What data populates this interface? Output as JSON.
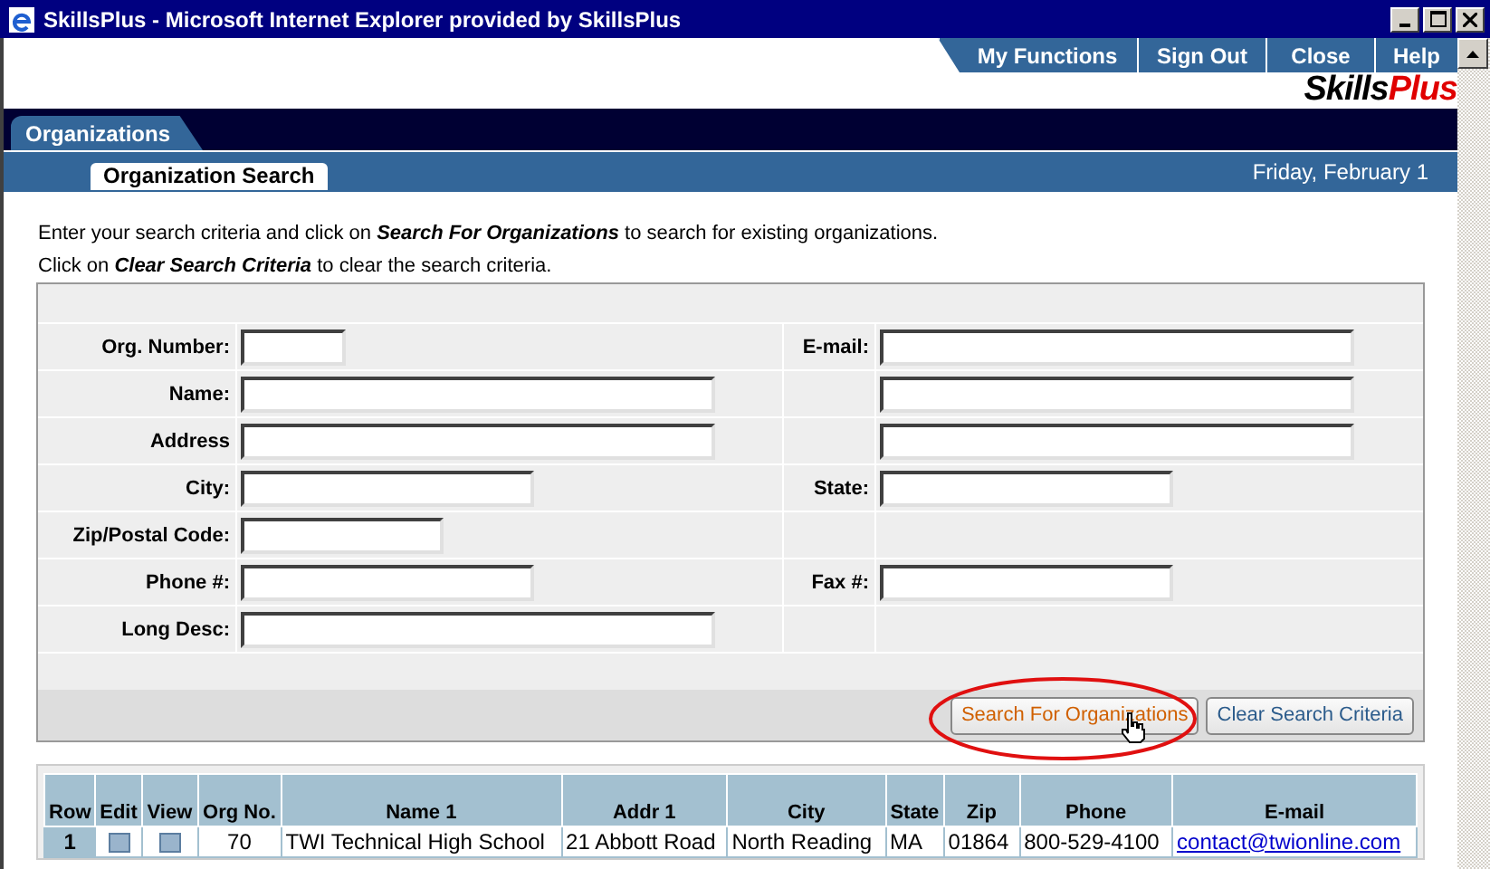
{
  "window": {
    "title": "SkillsPlus - Microsoft Internet Explorer provided by SkillsPlus"
  },
  "nav": {
    "buttons": [
      "My Functions",
      "Sign Out",
      "Close",
      "Help"
    ]
  },
  "logo": {
    "part_1": "Skills",
    "part_2": "Plus"
  },
  "tabs": [
    {
      "label": "Organizations",
      "selected": true
    }
  ],
  "subtabs": [
    {
      "label": "Organization Search",
      "selected": true
    }
  ],
  "date": "Friday, February 1",
  "instructions": [
    "Enter your search criteria and click on **Search For Organizations** to search for existing organizations.",
    "Click on **Clear Search Criteria** to clear the search criteria."
  ],
  "form": {
    "rows": [
      {
        "left_label": "Org. Number:",
        "right_label": "E-mail:"
      },
      {
        "left_label": "Name:",
        "right_label": ""
      },
      {
        "left_label": "Address",
        "right_label": ""
      },
      {
        "left_label": "City:",
        "right_label": "State:"
      },
      {
        "left_label": "Zip/Postal Code:",
        "right_label": ""
      },
      {
        "left_label": "Phone #:",
        "right_label": "Fax #:"
      },
      {
        "left_label": "Long Desc:",
        "right_label": ""
      }
    ],
    "buttons": [
      {
        "label": "Search For Organizations",
        "highlighted": true
      },
      {
        "label": "Clear Search Criteria",
        "highlighted": false
      }
    ]
  },
  "table": {
    "columns": [
      "Row",
      "Edit",
      "View",
      "Org No.",
      "Name 1",
      "Addr 1",
      "City",
      "State",
      "Zip",
      "Phone",
      "E-mail"
    ],
    "rows": [
      {
        "row": "1",
        "org_no": "70",
        "name_1": "TWI Technical High School",
        "addr_1": "21 Abbott Road",
        "city": "North Reading",
        "state": "MA",
        "zip": "01864",
        "phone": "800-529-4100",
        "email": "contact@twionline.com"
      }
    ]
  }
}
